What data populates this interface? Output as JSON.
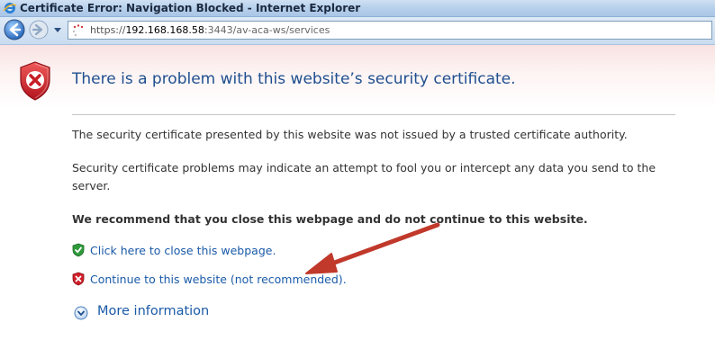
{
  "window": {
    "title": "Certificate Error: Navigation Blocked - Internet Explorer"
  },
  "address_bar": {
    "url_prefix": "https://",
    "url_host": "192.168.168.58",
    "url_path": ":3443/av-aca-ws/services"
  },
  "page": {
    "heading": "There is a problem with this website’s security certificate.",
    "paragraph_1": "The security certificate presented by this website was not issued by a trusted certificate authority.",
    "paragraph_2": "Security certificate problems may indicate an attempt to fool you or intercept any data you send to the server.",
    "recommendation": "We recommend that you close this webpage and do not continue to this website.",
    "close_link": "Click here to close this webpage.",
    "continue_link": "Continue to this website (not recommended)",
    "continue_suffix": ".",
    "more_info": "More information"
  },
  "colors": {
    "heading": "#1f4f8f",
    "link": "#1a5aa8",
    "arrow": "#c0392b",
    "shield_red": "#d0202a",
    "shield_green": "#2e9a3a"
  },
  "icons": [
    "ie-logo-icon",
    "back-arrow-icon",
    "forward-arrow-icon",
    "dropdown-icon",
    "page-loading-icon",
    "error-shield-icon",
    "green-shield-icon",
    "red-shield-icon",
    "expand-circle-icon",
    "annotation-arrow"
  ]
}
